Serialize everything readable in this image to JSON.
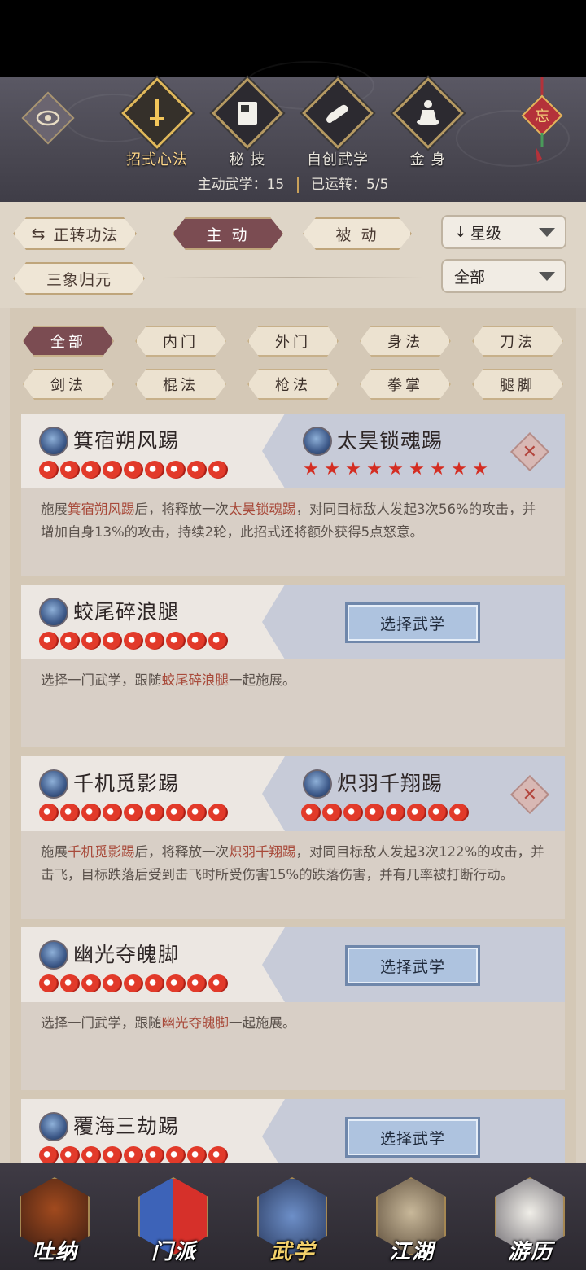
{
  "header": {
    "tabs": [
      {
        "label": "招式心法",
        "icon": "sword-icon",
        "active": true
      },
      {
        "label": "秘 技",
        "icon": "book-icon",
        "active": false
      },
      {
        "label": "自创武学",
        "icon": "scroll-icon",
        "active": false
      },
      {
        "label": "金 身",
        "icon": "meditation-icon",
        "active": false
      }
    ],
    "status_active_label": "主动武学：15",
    "status_run_label": "已运转：5/5",
    "charm_text": "忘"
  },
  "controls": {
    "zhengzhuan": "正转功法",
    "zhudong": "主 动",
    "beidong": "被 动",
    "sort_select": "星级",
    "sanxiang": "三象归元",
    "filter_select": "全部"
  },
  "filters": [
    "全部",
    "内门",
    "外门",
    "身法",
    "刀法",
    "剑法",
    "棍法",
    "枪法",
    "拳掌",
    "腿脚"
  ],
  "cards": [
    {
      "name": "箕宿朔风踢",
      "partner": "太昊锁魂踢",
      "stars": 9,
      "desc_pre": "施展",
      "desc_hl1": "箕宿朔风踢",
      "desc_mid": "后，将释放一次",
      "desc_hl2": "太昊锁魂踢",
      "desc_post": "，对同目标敌人发起3次56%的攻击，并增加自身13%的攻击，持续2轮，此招式还将额外获得5点怒意。"
    },
    {
      "name": "蛟尾碎浪腿",
      "button": "选择武学",
      "stars": 9,
      "desc_pre": "选择一门武学，跟随",
      "desc_hl1": "蛟尾碎浪腿",
      "desc_post": "一起施展。"
    },
    {
      "name": "千机觅影踢",
      "partner": "炽羽千翔踢",
      "stars": 9,
      "desc_pre": "施展",
      "desc_hl1": "千机觅影踢",
      "desc_mid": "后，将释放一次",
      "desc_hl2": "炽羽千翔踢",
      "desc_post": "，对同目标敌人发起3次122%的攻击，并击飞，目标跌落后受到击飞时所受伤害15%的跌落伤害，并有几率被打断行动。"
    },
    {
      "name": "幽光夺魄脚",
      "button": "选择武学",
      "stars": 9,
      "desc_pre": "选择一门武学，跟随",
      "desc_hl1": "幽光夺魄脚",
      "desc_post": "一起施展。"
    },
    {
      "name": "覆海三劫踢",
      "button": "选择武学",
      "stars": 9
    }
  ],
  "nav": [
    {
      "label": "吐纳",
      "icon": "monk-icon"
    },
    {
      "label": "门派",
      "icon": "flag-icon"
    },
    {
      "label": "武学",
      "icon": "manual-icon",
      "active": true
    },
    {
      "label": "江湖",
      "icon": "straw-hat-icon"
    },
    {
      "label": "游历",
      "icon": "horse-icon"
    }
  ]
}
